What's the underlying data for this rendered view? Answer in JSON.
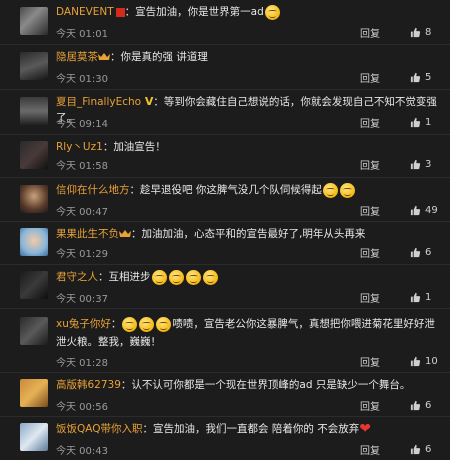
{
  "comments": [
    {
      "user": "DANEVENT",
      "text": "宣告加油，你是世界第一ad",
      "time": "今天 01:01",
      "reply": "回复",
      "likes": "8"
    },
    {
      "user": "隐居莫茶",
      "text": "你是真的强 讲道理",
      "time": "今天 01:30",
      "reply": "回复",
      "likes": "5"
    },
    {
      "user": "夏目_FinallyEcho",
      "text": "等到你会藏住自己想说的话，你就会发现自己不知不觉变强了。",
      "time": "今天 09:14",
      "reply": "回复",
      "likes": "1"
    },
    {
      "user": "Rly丶Uz1",
      "text": "加油宣告！",
      "time": "今天 01:58",
      "reply": "回复",
      "likes": "3"
    },
    {
      "user": "信仰在什么地方",
      "text": "趁早退役吧 你这脾气没几个队伺候得起",
      "time": "今天 00:47",
      "reply": "回复",
      "likes": "49"
    },
    {
      "user": "果果此生不负",
      "text": "加油加油，心态平和的宣告最好了,明年从头再来",
      "time": "今天 01:29",
      "reply": "回复",
      "likes": "6"
    },
    {
      "user": "君守之人",
      "text": "互相进步",
      "time": "今天 00:37",
      "reply": "回复",
      "likes": "1"
    },
    {
      "user": "xu兔子你好",
      "text": "啧啧，宣告老公你这暴脾气，真想把你喂进菊花里好好泄泄火粮。整我，巍巍！",
      "time": "今天 01:28",
      "reply": "回复",
      "likes": "10"
    },
    {
      "user": "高版韩62739",
      "text": "认不认可你都是一个现在世界顶峰的ad 只是缺少一个舞台。",
      "time": "今天 00:56",
      "reply": "回复",
      "likes": "6"
    },
    {
      "user": "饭饭QAQ带你入职",
      "text": "宣告加油，我们一直都会 陪着你的 不会放弃",
      "time": "今天 00:43",
      "reply": "回复",
      "likes": "6"
    }
  ],
  "icons": {
    "like": "thumbs-up-icon",
    "emoji": "smiley-emoji",
    "heart": "heart-emoji"
  },
  "colors": {
    "background": "#1c1c1c",
    "username": "#e9a236",
    "text": "#e8e8e8",
    "meta": "#9a9a9a",
    "heart": "#e8362e"
  }
}
